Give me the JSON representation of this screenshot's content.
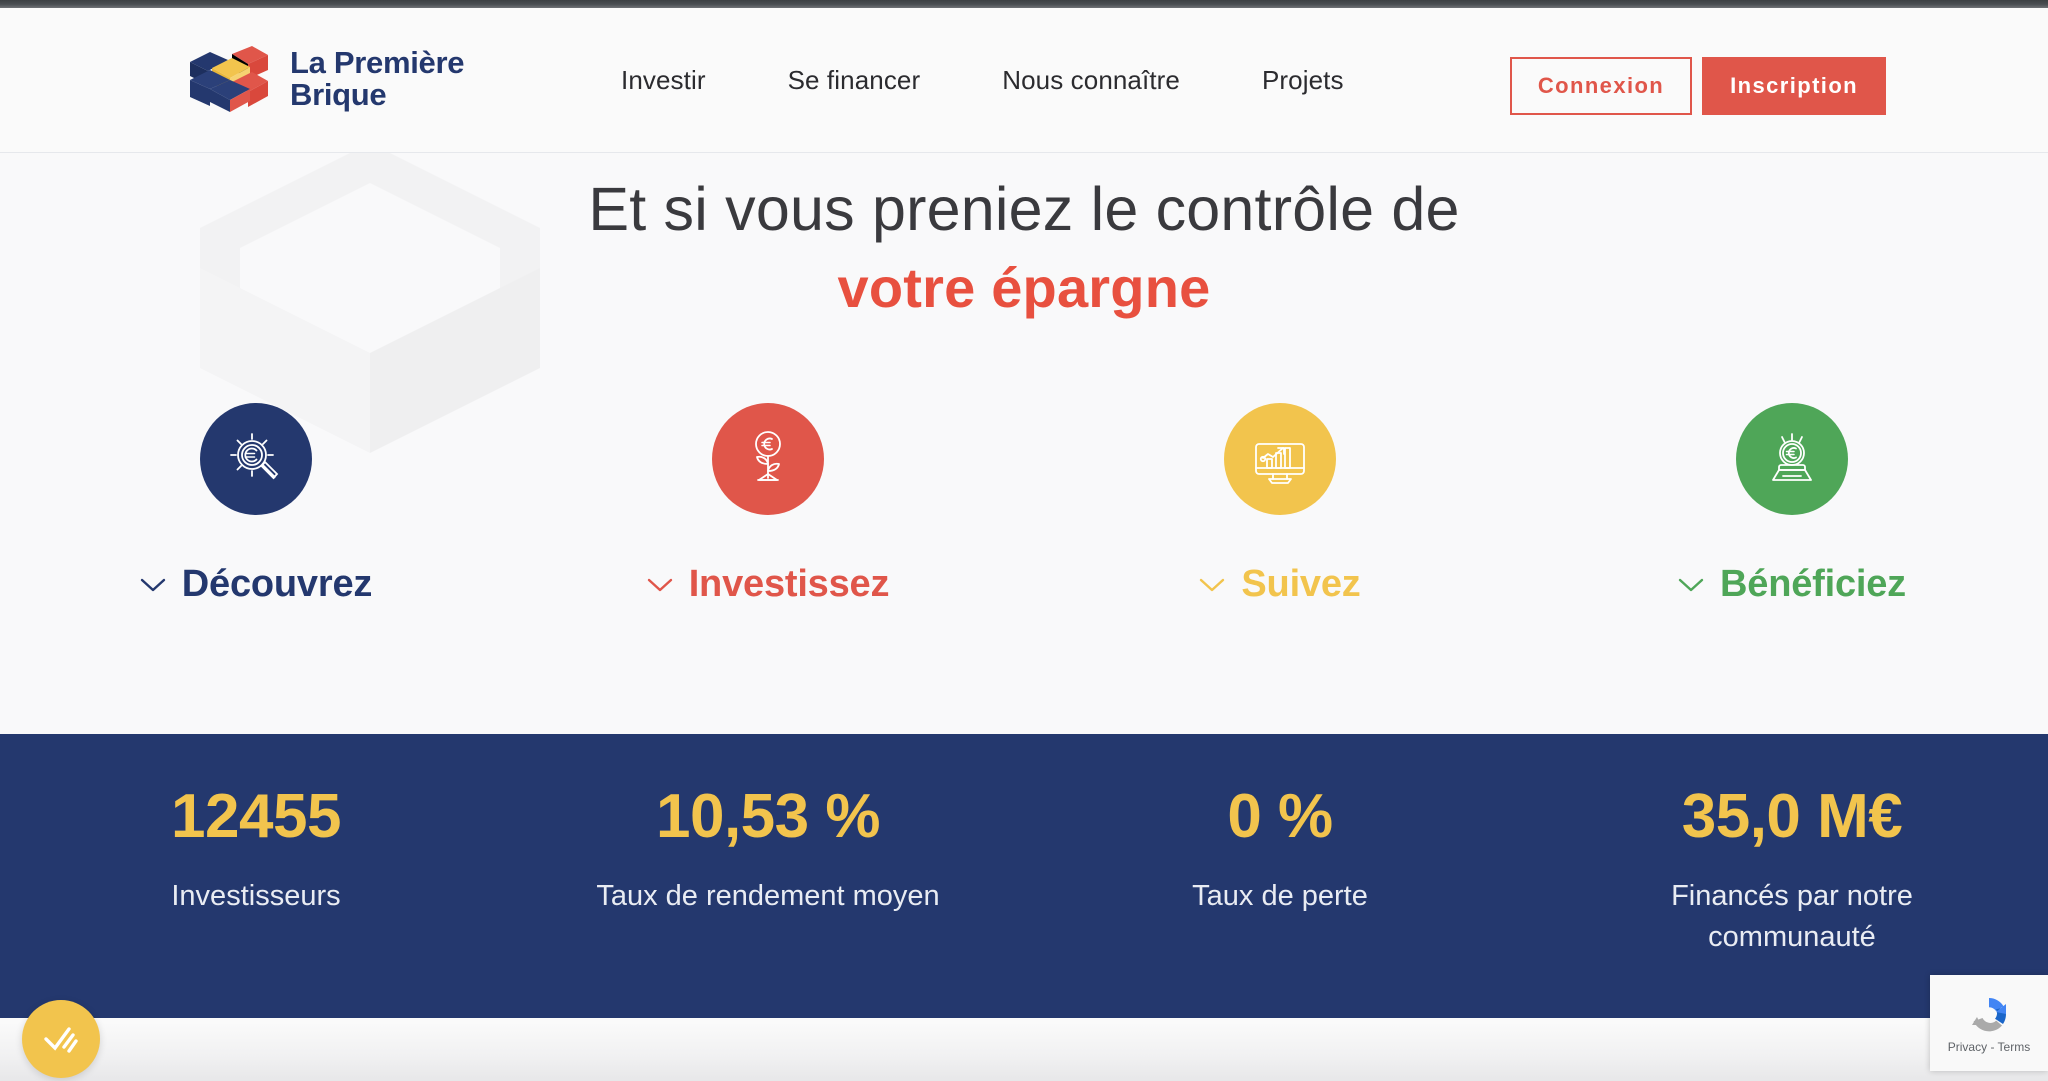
{
  "colors": {
    "navy": "#24386e",
    "coral": "#e0564a",
    "coral_heading": "#e8503f",
    "yellow": "#f2c44d",
    "green": "#4fa658",
    "header_bg": "#fafafa",
    "hero_bg": "#f9f9fa"
  },
  "header": {
    "logo": {
      "icon": "brick-logo-icon",
      "line1": "La Première",
      "line2": "Brique"
    },
    "nav": [
      {
        "label": "Investir",
        "name": "nav-investir"
      },
      {
        "label": "Se financer",
        "name": "nav-se-financer"
      },
      {
        "label": "Nous connaître",
        "name": "nav-nous-connaitre"
      },
      {
        "label": "Projets",
        "name": "nav-projets"
      }
    ],
    "login_label": "Connexion",
    "signup_label": "Inscription"
  },
  "hero": {
    "title_line1": "Et si vous preniez le contrôle de",
    "title_line2": "votre épargne",
    "watermark_icon": "isometric-brick-watermark",
    "steps": [
      {
        "label": "Découvrez",
        "color": "#24386e",
        "icon": "magnifier-euro-icon",
        "name": "step-decouvrez"
      },
      {
        "label": "Investissez",
        "color": "#e0564a",
        "icon": "euro-plant-icon",
        "name": "step-investissez"
      },
      {
        "label": "Suivez",
        "color": "#f2c44d",
        "icon": "monitor-chart-icon",
        "name": "step-suivez"
      },
      {
        "label": "Bénéficiez",
        "color": "#4fa658",
        "icon": "euro-trophy-icon",
        "name": "step-beneficiez"
      }
    ]
  },
  "stats": [
    {
      "value": "12455",
      "label": "Investisseurs",
      "name": "stat-investisseurs"
    },
    {
      "value": "10,53 %",
      "label": "Taux de rendement moyen",
      "name": "stat-rendement"
    },
    {
      "value": "0 %",
      "label": "Taux de perte",
      "name": "stat-perte"
    },
    {
      "value": "35,0 M€",
      "label": "Financés par notre communauté",
      "name": "stat-finances"
    }
  ],
  "widgets": {
    "consent_icon": "check-swipe-icon",
    "recaptcha_icon": "recaptcha-icon",
    "recaptcha_label": "Privacy - Terms"
  }
}
